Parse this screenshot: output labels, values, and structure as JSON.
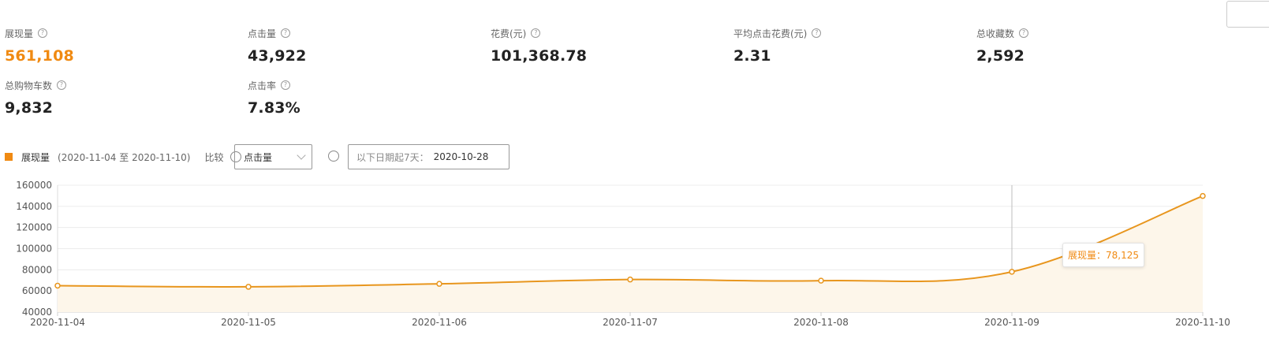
{
  "metrics": [
    {
      "label": "展现量",
      "value": "561,108",
      "highlight": true
    },
    {
      "label": "点击量",
      "value": "43,922"
    },
    {
      "label": "花费(元)",
      "value": "101,368.78"
    },
    {
      "label": "平均点击花费(元)",
      "value": "2.31"
    },
    {
      "label": "总收藏数",
      "value": "2,592"
    },
    {
      "label": "总购物车数",
      "value": "9,832"
    },
    {
      "label": "点击率",
      "value": "7.83%"
    }
  ],
  "controls": {
    "series_name": "展现量",
    "date_range": "(2020-11-04 至 2020-11-10)",
    "compare_label": "比较",
    "compare_select_value": "点击量",
    "prior_label": "以下日期起7天：",
    "prior_date": "2020-10-28"
  },
  "tooltip": {
    "text": "展现量：78,125"
  },
  "colors": {
    "accent": "#f08a12",
    "line": "#e8961e",
    "grid": "#ececec"
  },
  "chart_data": {
    "type": "line",
    "categories": [
      "2020-11-04",
      "2020-11-05",
      "2020-11-06",
      "2020-11-07",
      "2020-11-08",
      "2020-11-09",
      "2020-11-10"
    ],
    "series": [
      {
        "name": "展现量",
        "values": [
          65000,
          63900,
          66700,
          70800,
          69700,
          78125,
          149800
        ]
      }
    ],
    "yticks": [
      40000,
      60000,
      80000,
      100000,
      120000,
      140000,
      160000
    ],
    "ylim": [
      40000,
      160000
    ],
    "grid": true,
    "highlight_index": 5
  }
}
